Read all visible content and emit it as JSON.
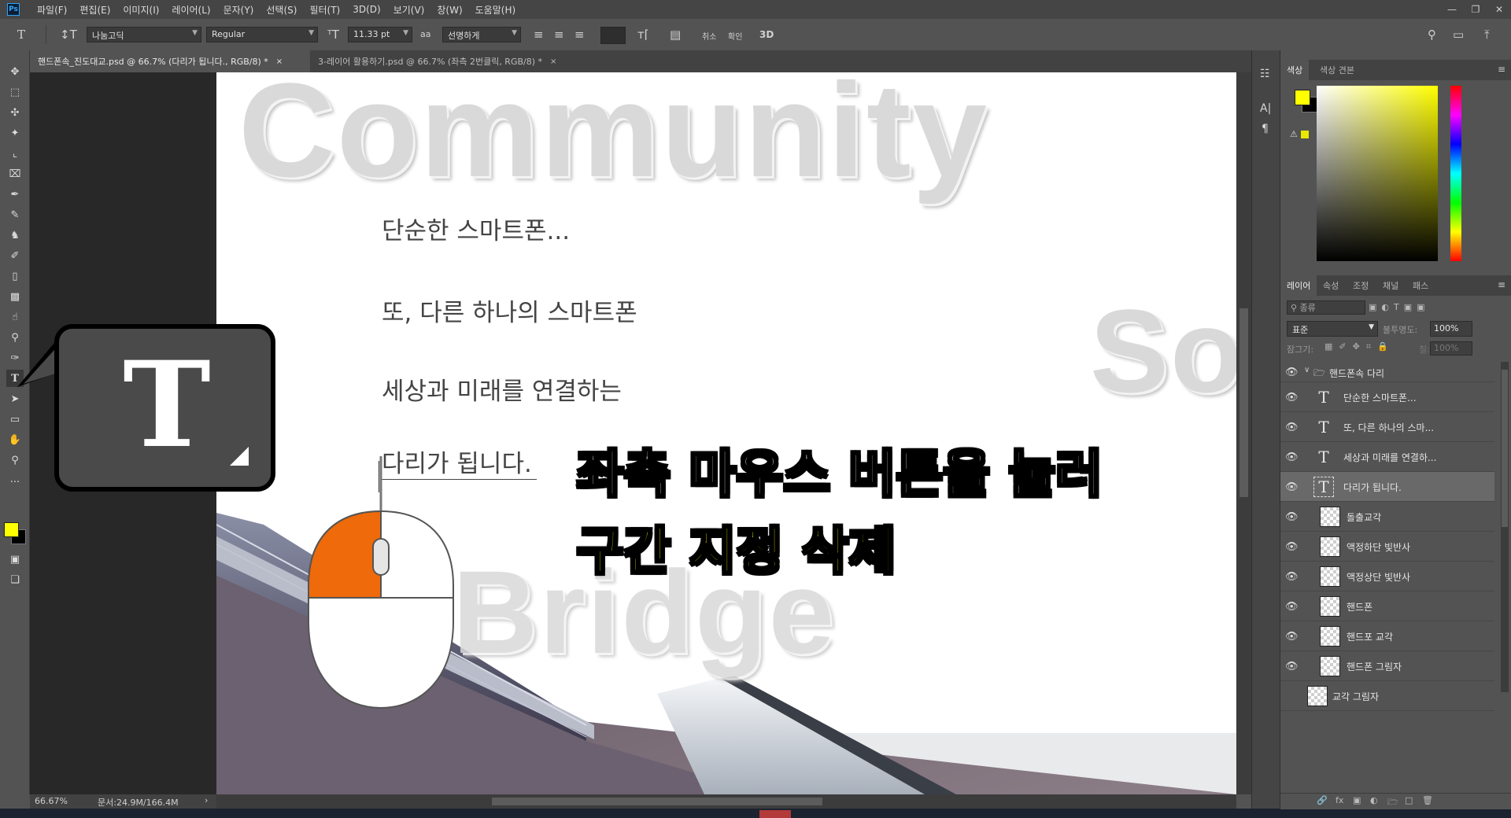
{
  "app": {
    "logo": "Ps",
    "menu": [
      "파일(F)",
      "편집(E)",
      "이미지(I)",
      "레이어(L)",
      "문자(Y)",
      "선택(S)",
      "필터(T)",
      "3D(D)",
      "보기(V)",
      "창(W)",
      "도움말(H)"
    ]
  },
  "options": {
    "font_family": "나눔고딕",
    "font_style": "Regular",
    "font_size": "11.33 pt",
    "antialias_label": "aa",
    "antialias": "선명하게",
    "cancel_label": "취소",
    "commit_label": "확인",
    "threed_label": "3D"
  },
  "tabs": [
    {
      "label": "핸드폰속_진도대교.psd @ 66.7% (다리가 됩니다., RGB/8) *",
      "close": "×"
    },
    {
      "label": "3-레이어 활용하기.psd @ 66.7% (좌측 2번클릭, RGB/8) *",
      "close": "×"
    }
  ],
  "canvas": {
    "word_community": "Community",
    "word_so": "So",
    "word_bridge": "Bridge",
    "line1": "단순한 스마트폰...",
    "line2": "또, 다른 하나의 스마트폰",
    "line3": "세상과 미래를 연결하는",
    "line4": "다리가 됩니다."
  },
  "overlay": {
    "tool_glyph": "T",
    "instruction1": "좌측 마우스 버튼을 눌러",
    "instruction2": "구간 지정 삭제",
    "colors": {
      "accent": "#ffff00",
      "mouse_button": "#ee6a0a",
      "text_outline": "#000000"
    }
  },
  "status": {
    "zoom": "66.67%",
    "doc_size": "문서:24.9M/166.4M"
  },
  "color_panel": {
    "tabs": [
      "색상",
      "색상 견본"
    ],
    "foreground": "#ffff00",
    "background": "#000000"
  },
  "layers_panel": {
    "tabs": [
      "레이어",
      "속성",
      "조정",
      "채널",
      "패스"
    ],
    "filter_label": "종류",
    "blend_mode": "표준",
    "opacity_label": "불투명도:",
    "opacity": "100%",
    "lock_label": "잠그기:",
    "fill_label": "칠:",
    "fill": "100%",
    "group_name": "핸드폰속 다리",
    "layers": [
      {
        "name": "단순한 스마트폰...",
        "kind": "text",
        "selected": false
      },
      {
        "name": "또, 다른 하나의 스마...",
        "kind": "text",
        "selected": false
      },
      {
        "name": "세상과 미래를 연결하...",
        "kind": "text",
        "selected": false
      },
      {
        "name": "다리가 됩니다.",
        "kind": "text",
        "selected": true
      },
      {
        "name": "돌출교각",
        "kind": "pixel",
        "selected": false
      },
      {
        "name": "액정하단 빛반사",
        "kind": "pixel",
        "selected": false
      },
      {
        "name": "액정상단 빛반사",
        "kind": "pixel",
        "selected": false
      },
      {
        "name": "핸드폰",
        "kind": "pixel",
        "selected": false
      },
      {
        "name": "핸드포 교각",
        "kind": "pixel",
        "selected": false
      },
      {
        "name": "핸드폰 그림자",
        "kind": "pixel",
        "selected": false
      },
      {
        "name": "교각 그림자",
        "kind": "pixel",
        "selected": false
      }
    ]
  },
  "icons": [
    "move-icon",
    "marquee-icon",
    "lasso-icon",
    "magic-wand-icon",
    "crop-icon",
    "frame-icon",
    "eyedropper-icon",
    "brush-icon",
    "stamp-icon",
    "history-brush-icon",
    "eraser-icon",
    "gradient-icon",
    "smudge-icon",
    "dodge-icon",
    "pen-icon",
    "type-icon",
    "path-select-icon",
    "shape-icon",
    "hand-icon",
    "zoom-icon",
    "eye-icon",
    "folder-icon",
    "search-icon",
    "lock-icon"
  ]
}
